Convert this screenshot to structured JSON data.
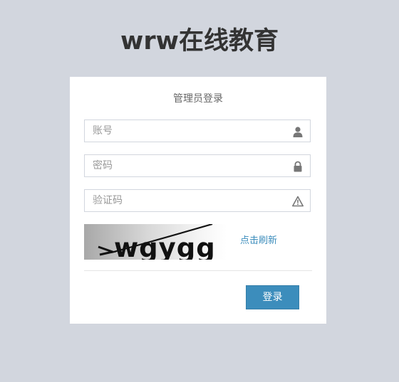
{
  "site": {
    "title": "wrw在线教育"
  },
  "login": {
    "title": "管理员登录",
    "fields": {
      "account": {
        "placeholder": "账号",
        "icon": "user-icon"
      },
      "password": {
        "placeholder": "密码",
        "icon": "lock-icon"
      },
      "captcha": {
        "placeholder": "验证码",
        "icon": "warning-icon"
      }
    },
    "captcha_image_text": "wgygg",
    "refresh_label": "点击刷新",
    "submit_label": "登录"
  },
  "colors": {
    "page_background": "#d2d6de",
    "accent": "#3c8dbc",
    "icon": "#777777"
  }
}
